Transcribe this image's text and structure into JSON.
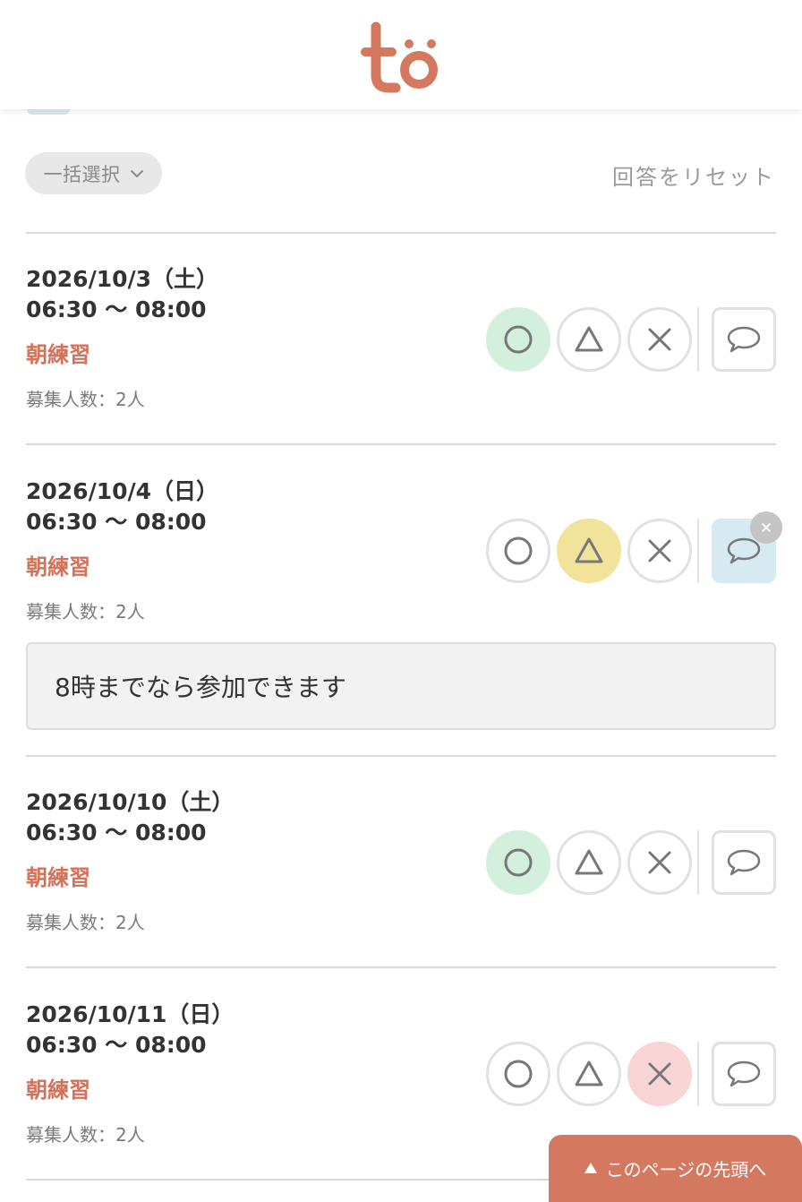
{
  "header": {
    "logo_text": "to",
    "logo_color": "#d4785f"
  },
  "toolbar": {
    "bulk_select_label": "一括選択",
    "reset_label": "回答をリセット"
  },
  "entries": [
    {
      "date": "2026/10/3（土）",
      "time": "06:30 〜 08:00",
      "event": "朝練習",
      "capacity": "募集人数：2人",
      "selected": "ok",
      "comment": ""
    },
    {
      "date": "2026/10/4（日）",
      "time": "06:30 〜 08:00",
      "event": "朝練習",
      "capacity": "募集人数：2人",
      "selected": "maybe",
      "comment": "8時までなら参加できます"
    },
    {
      "date": "2026/10/10（土）",
      "time": "06:30 〜 08:00",
      "event": "朝練習",
      "capacity": "募集人数：2人",
      "selected": "ok",
      "comment": ""
    },
    {
      "date": "2026/10/11（日）",
      "time": "06:30 〜 08:00",
      "event": "朝練習",
      "capacity": "募集人数：2人",
      "selected": "no",
      "comment": ""
    }
  ],
  "icons": {
    "ok": "circle-icon",
    "maybe": "triangle-icon",
    "no": "cross-icon",
    "comment": "speech-bubble-icon",
    "clear": "close-icon",
    "bulk_dropdown": "chevron-down-icon",
    "scroll_top": "triangle-up-icon"
  },
  "colors": {
    "accent": "#d4785f",
    "ok_selected": "#d3f0dc",
    "maybe_selected": "#f1e39a",
    "no_selected": "#f8d4d4",
    "comment_active": "#d6eaf2"
  },
  "footer": {
    "to_top_label": "このページの先頭へ"
  }
}
